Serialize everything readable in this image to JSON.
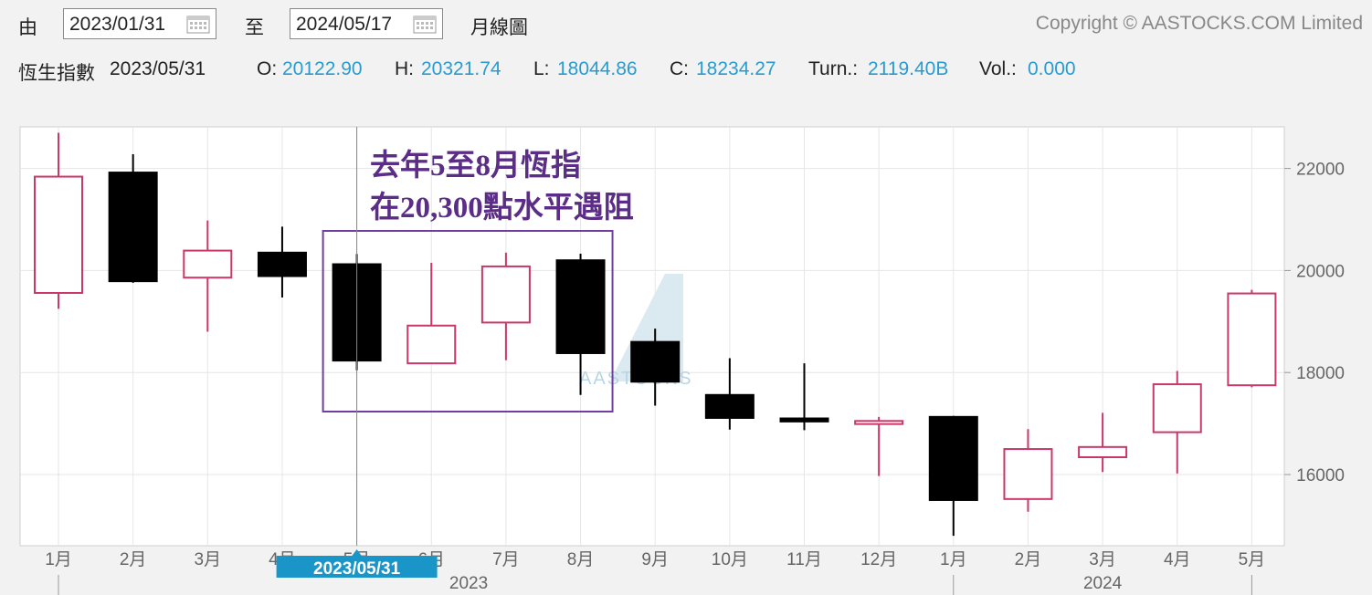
{
  "header": {
    "from_label": "由",
    "from_date": "2023/01/31",
    "to_label": "至",
    "to_date": "2024/05/17",
    "chart_kind": "月線圖",
    "copyright": "Copyright © AASTOCKS.COM Limited"
  },
  "info": {
    "index_name": "恆生指數",
    "date": "2023/05/31",
    "open_label": "O:",
    "open": "20122.90",
    "high_label": "H:",
    "high": "20321.74",
    "low_label": "L:",
    "low": "18044.86",
    "close_label": "C:",
    "close": "18234.27",
    "turn_label": "Turn.:",
    "turn": "2119.40B",
    "vol_label": "Vol.:",
    "vol": "0.000"
  },
  "colors": {
    "up": "#c8386b",
    "down": "#000000",
    "value": "#2a9bd0",
    "annotation": "#5b2d86",
    "cursor_tag": "#1a95c8"
  },
  "chart_data": {
    "type": "candlestick",
    "categories": [
      "1月",
      "2月",
      "3月",
      "4月",
      "5月",
      "6月",
      "7月",
      "8月",
      "9月",
      "10月",
      "11月",
      "12月",
      "1月",
      "2月",
      "3月",
      "4月",
      "5月"
    ],
    "year_labels": [
      {
        "label": "2023",
        "start_index": 0,
        "end_index": 11
      },
      {
        "label": "2024",
        "start_index": 12,
        "end_index": 16
      }
    ],
    "candles": [
      {
        "o": 19560,
        "h": 22700,
        "l": 19250,
        "c": 21840
      },
      {
        "o": 21920,
        "h": 22280,
        "l": 19760,
        "c": 19790
      },
      {
        "o": 19860,
        "h": 20980,
        "l": 18800,
        "c": 20390
      },
      {
        "o": 20350,
        "h": 20860,
        "l": 19470,
        "c": 19890
      },
      {
        "o": 20122.9,
        "h": 20321.74,
        "l": 18044.86,
        "c": 18234.27
      },
      {
        "o": 18180,
        "h": 20150,
        "l": 18170,
        "c": 18920
      },
      {
        "o": 18980,
        "h": 20350,
        "l": 18240,
        "c": 20080
      },
      {
        "o": 20200,
        "h": 20330,
        "l": 17560,
        "c": 18380
      },
      {
        "o": 18600,
        "h": 18860,
        "l": 17350,
        "c": 17820
      },
      {
        "o": 17560,
        "h": 18280,
        "l": 16880,
        "c": 17110
      },
      {
        "o": 17100,
        "h": 18180,
        "l": 16870,
        "c": 17040
      },
      {
        "o": 16990,
        "h": 17130,
        "l": 15970,
        "c": 17050
      },
      {
        "o": 17130,
        "h": 17150,
        "l": 14800,
        "c": 15500
      },
      {
        "o": 15520,
        "h": 16890,
        "l": 15270,
        "c": 16500
      },
      {
        "o": 16340,
        "h": 17210,
        "l": 16050,
        "c": 16540
      },
      {
        "o": 16830,
        "h": 18030,
        "l": 16020,
        "c": 17770
      },
      {
        "o": 17750,
        "h": 19620,
        "l": 17710,
        "c": 19550
      }
    ],
    "y_ticks": [
      16000,
      18000,
      20000,
      22000
    ],
    "ylim": [
      14500,
      23000
    ],
    "grid": true,
    "cursor": {
      "index": 4,
      "label": "2023/05/31"
    },
    "annotation": {
      "lines": [
        "去年5至8月恆指",
        "在20,300點水平遇阻"
      ],
      "box_from_index": 4,
      "box_to_index": 7
    },
    "watermark": "AASTOCKS"
  }
}
